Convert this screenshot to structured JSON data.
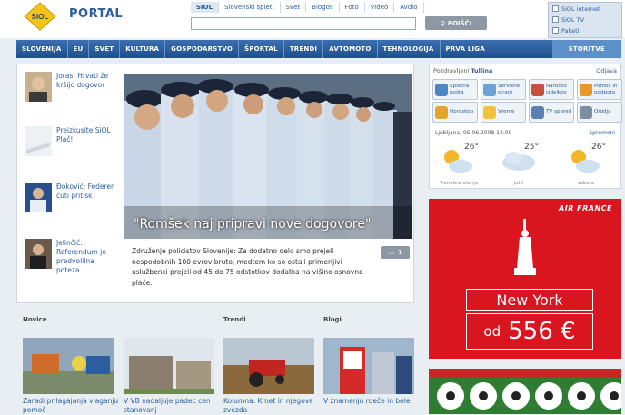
{
  "header": {
    "logo_text": "SiOL",
    "portal": "PORTAL",
    "search_tabs": [
      "SIOL",
      "Slovenski spleti",
      "Svet",
      "Blogos",
      "Foto",
      "Video",
      "Avdio"
    ],
    "search_placeholder": "",
    "search_button": "POIŠČI",
    "services": [
      "SiOL internet",
      "SiOL TV",
      "Paketi"
    ]
  },
  "nav": [
    "SLOVENIJA",
    "EU",
    "SVET",
    "KULTURA",
    "GOSPODARSTVO",
    "ŠPORTAL",
    "TRENDI",
    "AVTOMOTO",
    "TEHNOLOGIJA",
    "PRVA LIGA",
    "STORITVE"
  ],
  "sidebar": [
    {
      "text": "Joras: Hrvati že kršijo dogovor"
    },
    {
      "text": "Preizkusite SiOL Plač!"
    },
    {
      "text": "Đoković: Federer čuti pritisk"
    },
    {
      "text": "Jelinčič: Referendum je predvolilna poteza"
    }
  ],
  "hero": {
    "caption": "\"Romšek naj pripravi nove dogovore\"",
    "description": "Združenje policistov Slovenije: Za dodatno delo smo prejeli nespodobnih 100 evrov bruto, medtem ko so ostali primerljivi uslužbenci prejeli od 45 do 75 odstotkov dodatka na višino osnovne plače.",
    "comments": "1"
  },
  "bottom": [
    {
      "section": "Novice",
      "text": "Zaradi prilagajanja vlaganju pomoč"
    },
    {
      "section": "",
      "text": "V VB nadaljuje padec cen stanovanj"
    },
    {
      "section": "Trendi",
      "text": "Kolumna: Kmet in njegova zvezda"
    },
    {
      "section": "Blogi",
      "text": "V znamenju rdeče in bele"
    }
  ],
  "right": {
    "greeting": "Pozdravljeni",
    "user": "Tullina",
    "edit_link": "Odjava",
    "quick": [
      {
        "label": "Spletna pošta",
        "color": "#4d86c6"
      },
      {
        "label": "Servisne strani",
        "color": "#6aa2d6"
      },
      {
        "label": "Naročilo izdelkov",
        "color": "#c4503d"
      },
      {
        "label": "Pomoč in podpora",
        "color": "#e59a2b"
      },
      {
        "label": "Horoskop",
        "color": "#e2a62a"
      },
      {
        "label": "Vreme",
        "color": "#f3c23a"
      },
      {
        "label": "TV spored",
        "color": "#5b7fb3"
      },
      {
        "label": "Orodja",
        "color": "#7e8da0"
      }
    ],
    "weather_location": "Ljubljana, 05.06.2008 14:00",
    "weather_link": "Spremeni",
    "weather": [
      {
        "temp": "26°",
        "name": "Trenutno stanje"
      },
      {
        "temp": "25°",
        "name": "jutri"
      },
      {
        "temp": "26°",
        "name": "sobota"
      }
    ]
  },
  "ad": {
    "brand": "AIR FRANCE",
    "city": "New York",
    "price_prefix": "od",
    "price": "556 €"
  }
}
